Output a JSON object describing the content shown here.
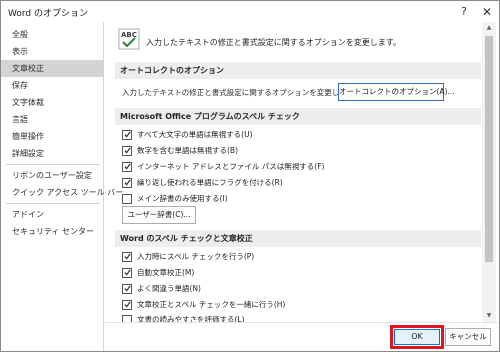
{
  "window": {
    "title": "Word のオプション",
    "help_glyph": "?",
    "close_glyph": "✕"
  },
  "sidebar": {
    "items": [
      {
        "label": "全般"
      },
      {
        "label": "表示"
      },
      {
        "label": "文章校正",
        "active": true
      },
      {
        "label": "保存"
      },
      {
        "label": "文字体裁"
      },
      {
        "label": "言語"
      },
      {
        "label": "簡単操作"
      },
      {
        "label": "詳細設定"
      },
      {
        "label": "リボンのユーザー設定"
      },
      {
        "label": "クイック アクセス ツール バー"
      },
      {
        "label": "アドイン"
      },
      {
        "label": "セキュリティ センター"
      }
    ]
  },
  "main": {
    "icon": "abc-check-icon",
    "intro": "入力したテキストの修正と書式設定に関するオプションを変更します。",
    "autocorrect_section": {
      "header": "オートコレクトのオプション",
      "description": "入力したテキストの修正と書式設定に関するオプションを変更します。",
      "button": "オートコレクトのオプション(A)..."
    },
    "office_spell_section": {
      "header": "Microsoft Office プログラムのスペル チェック",
      "options": [
        {
          "label": "すべて大文字の単語は無視する(U)",
          "checked": true
        },
        {
          "label": "数字を含む単語は無視する(B)",
          "checked": true
        },
        {
          "label": "インターネット アドレスとファイル パスは無視する(F)",
          "checked": true
        },
        {
          "label": "繰り返し使われる単語にフラグを付ける(R)",
          "checked": true
        },
        {
          "label": "メイン辞書のみ使用する(I)",
          "checked": false
        }
      ],
      "dict_button": "ユーザー辞書(C)..."
    },
    "word_spell_section": {
      "header": "Word のスペル チェックと文章校正",
      "options": [
        {
          "label": "入力時にスペル チェックを行う(P)",
          "checked": true
        },
        {
          "label": "自動文章校正(M)",
          "checked": true
        },
        {
          "label": "よく間違う単語(N)",
          "checked": true
        },
        {
          "label": "文章校正とスペル チェックを一緒に行う(H)",
          "checked": true
        },
        {
          "label": "文書の読みやすさを評価する(L)",
          "checked": false
        }
      ]
    }
  },
  "footer": {
    "ok": "OK",
    "cancel": "キャンセル"
  },
  "colors": {
    "highlight": "#e0131f",
    "ok_border": "#0078d7",
    "sidebar_active": "#d4d4d4"
  }
}
